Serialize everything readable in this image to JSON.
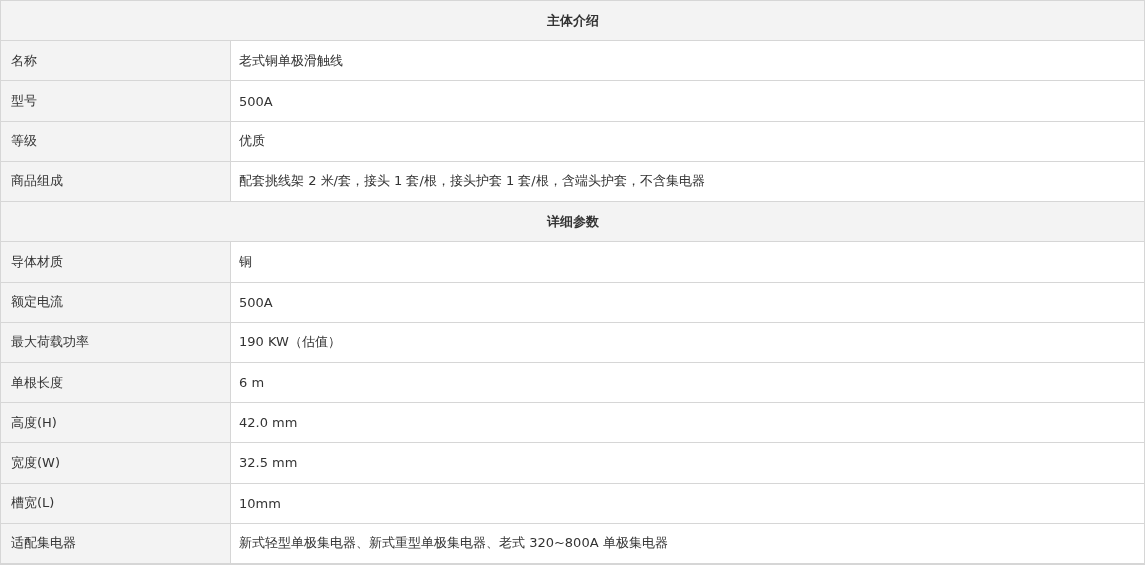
{
  "sections": [
    {
      "title": "主体介绍",
      "rows": [
        {
          "label": "名称",
          "value": "老式铜单极滑触线"
        },
        {
          "label": "型号",
          "value": "500A"
        },
        {
          "label": "等级",
          "value": "优质"
        },
        {
          "label": "商品组成",
          "value": "配套挑线架 2 米/套，接头 1 套/根，接头护套 1 套/根，含端头护套，不含集电器"
        }
      ]
    },
    {
      "title": "详细参数",
      "rows": [
        {
          "label": "导体材质",
          "value": "铜"
        },
        {
          "label": "额定电流",
          "value": "500A"
        },
        {
          "label": "最大荷载功率",
          "value": "190 KW（估值）"
        },
        {
          "label": "单根长度",
          "value": "6 m"
        },
        {
          "label": "高度(H)",
          "value": "42.0 mm"
        },
        {
          "label": "宽度(W)",
          "value": "32.5 mm"
        },
        {
          "label": "槽宽(L)",
          "value": "10mm"
        },
        {
          "label": "适配集电器",
          "value": "新式轻型单极集电器、新式重型单极集电器、老式 320~800A 单极集电器"
        }
      ]
    }
  ]
}
